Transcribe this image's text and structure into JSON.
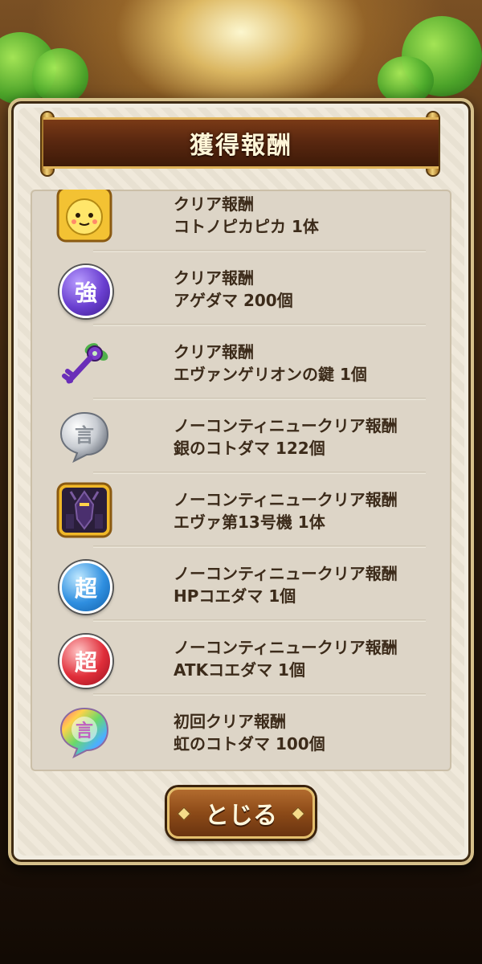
{
  "dialog": {
    "title": "獲得報酬",
    "close_label": "とじる"
  },
  "rewards": [
    {
      "line1": "クリア報酬",
      "line2": "コトノピカピカ 1体",
      "icon": "character-kotonopikapika-icon"
    },
    {
      "line1": "クリア報酬",
      "line2": "アゲダマ 200個",
      "icon": "agedama-strength-orb-icon",
      "glyph": "強"
    },
    {
      "line1": "クリア報酬",
      "line2": "エヴァンゲリオンの鍵 1個",
      "icon": "evangelion-key-icon"
    },
    {
      "line1": "ノーコンティニュークリア報酬",
      "line2": "銀のコトダマ 122個",
      "icon": "silver-kotodama-icon",
      "glyph": "言"
    },
    {
      "line1": "ノーコンティニュークリア報酬",
      "line2": "エヴァ第13号機 1体",
      "icon": "character-eva-unit-13-icon"
    },
    {
      "line1": "ノーコンティニュークリア報酬",
      "line2": "HPコエダマ 1個",
      "icon": "hp-koedama-orb-icon",
      "glyph": "超"
    },
    {
      "line1": "ノーコンティニュークリア報酬",
      "line2": "ATKコエダマ 1個",
      "icon": "atk-koedama-orb-icon",
      "glyph": "超"
    },
    {
      "line1": "初回クリア報酬",
      "line2": "虹のコトダマ 100個",
      "icon": "rainbow-kotodama-icon",
      "glyph": "言"
    }
  ],
  "colors": {
    "panel": "#efe8d9",
    "title_bar": "#5a2810",
    "text": "#3c2b1a",
    "strength_orb": "#6a3fd0",
    "hp_orb": "#2f8fe0",
    "atk_orb": "#e02e3a"
  }
}
